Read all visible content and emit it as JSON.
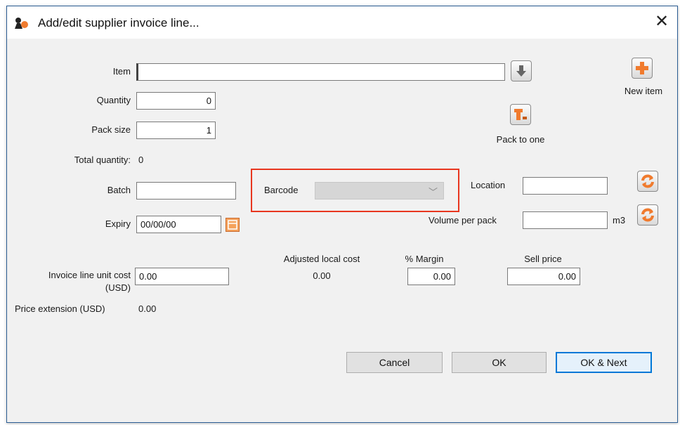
{
  "window": {
    "title": "Add/edit supplier invoice line...",
    "close_symbol": "✕"
  },
  "item": {
    "label": "Item",
    "value": ""
  },
  "new_item": {
    "label": "New item"
  },
  "quantity": {
    "label": "Quantity",
    "value": "0"
  },
  "pack_size": {
    "label": "Pack size",
    "value": "1"
  },
  "pack_to_one": {
    "label": "Pack to one"
  },
  "total_quantity": {
    "label": "Total quantity:",
    "value": "0"
  },
  "batch": {
    "label": "Batch",
    "value": ""
  },
  "barcode": {
    "label": "Barcode",
    "value": ""
  },
  "location": {
    "label": "Location",
    "value": ""
  },
  "expiry": {
    "label": "Expiry",
    "value": "00/00/00"
  },
  "volume_per_pack": {
    "label": "Volume per pack",
    "value": "",
    "unit": "m3"
  },
  "invoice_line_unit_cost": {
    "label_line1": "Invoice line unit cost",
    "label_line2": "(USD)",
    "value": "0.00"
  },
  "adjusted_local_cost": {
    "label": "Adjusted local cost",
    "value": "0.00"
  },
  "margin": {
    "label": "% Margin",
    "value": "0.00"
  },
  "sell_price": {
    "label": "Sell price",
    "value": "0.00"
  },
  "price_extension": {
    "label": "Price extension (USD)",
    "value": "0.00"
  },
  "buttons": {
    "cancel": "Cancel",
    "ok": "OK",
    "ok_next": "OK & Next"
  },
  "colors": {
    "highlight": "#e8361f",
    "accent": "#0078d7",
    "icon_orange": "#f07b2e"
  }
}
